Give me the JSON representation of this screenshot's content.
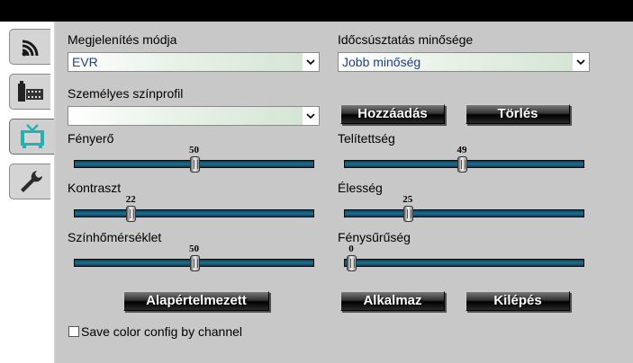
{
  "tabs": [
    {
      "icon": "antenna-icon",
      "active": false
    },
    {
      "icon": "film-icon",
      "active": false
    },
    {
      "icon": "tv-icon",
      "active": true
    },
    {
      "icon": "wrench-icon",
      "active": false
    }
  ],
  "display_mode": {
    "label": "Megjelenítés módja",
    "value": "EVR"
  },
  "timeshift_quality": {
    "label": "Időcsúsztatás minősége",
    "value": "Jobb minőség"
  },
  "color_profile": {
    "label": "Személyes színprofil",
    "value": ""
  },
  "buttons": {
    "add": "Hozzáadás",
    "delete": "Törlés",
    "default": "Alapértelmezett",
    "apply": "Alkalmaz",
    "exit": "Kilépés"
  },
  "sliders": {
    "brightness": {
      "label": "Fényerő",
      "value": "50",
      "fraction": 0.5
    },
    "saturation": {
      "label": "Telítettség",
      "value": "49",
      "fraction": 0.49
    },
    "contrast": {
      "label": "Kontraszt",
      "value": "22",
      "fraction": 0.22
    },
    "sharpness": {
      "label": "Élesség",
      "value": "25",
      "fraction": 0.25
    },
    "color_temp": {
      "label": "Színhőmérséklet",
      "value": "50",
      "fraction": 0.5
    },
    "density": {
      "label": "Fénysűrűség",
      "value": "0",
      "fraction": 0.0
    }
  },
  "save_config": {
    "label": "Save color config by channel",
    "checked": false
  },
  "colors": {
    "accent_tab": "#1fb3b3",
    "slider_track": "#1f6f91",
    "combo_text": "#1f3f8f"
  }
}
